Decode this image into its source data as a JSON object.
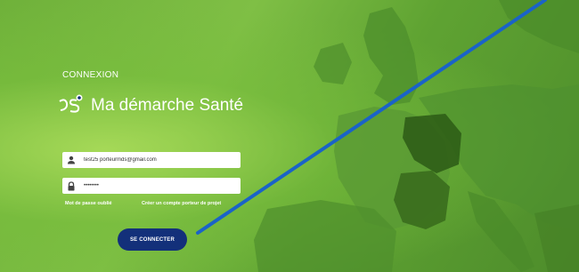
{
  "login": {
    "heading": "CONNEXION",
    "brand_main": "Ma démarche",
    "brand_accent": "Santé",
    "email_value": "test25 porteurmds@gmail.com",
    "password_value": "••••••••",
    "forgot_label": "Mot de passe oublié",
    "create_label": "Créer un compte porteur de projet",
    "submit_label": "SE CONNECTER"
  },
  "colors": {
    "button": "#13307a",
    "background_green": "#6fb13a",
    "annotation_line": "#1a63c8"
  },
  "icons": [
    "user-icon",
    "lock-icon",
    "ds-logo-icon"
  ]
}
